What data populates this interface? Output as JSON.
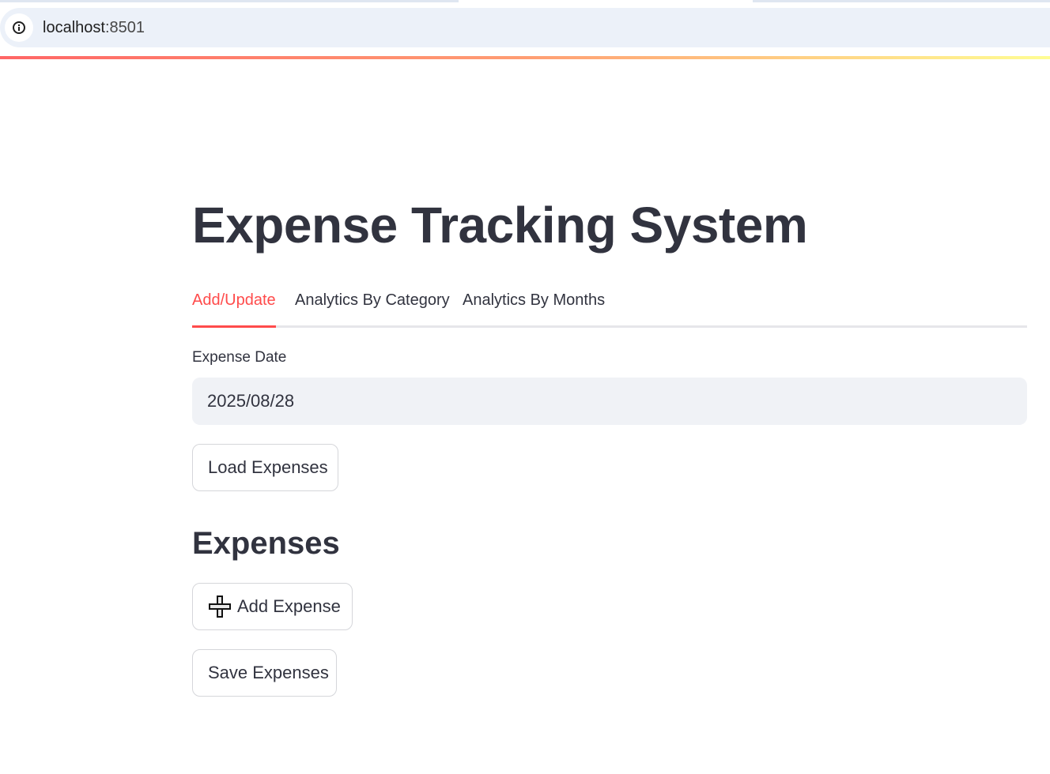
{
  "browser": {
    "url_host": "localhost",
    "url_port": ":8501"
  },
  "page": {
    "title": "Expense Tracking System"
  },
  "tabs": [
    {
      "label": "Add/Update",
      "active": true
    },
    {
      "label": "Analytics By Category",
      "active": false
    },
    {
      "label": "Analytics By Months",
      "active": false
    }
  ],
  "form": {
    "date_label": "Expense Date",
    "date_value": "2025/08/28",
    "load_button": "Load Expenses"
  },
  "expenses": {
    "heading": "Expenses",
    "add_button": "Add Expense",
    "add_button_icon": "plus-icon",
    "save_button": "Save Expenses"
  },
  "colors": {
    "accent": "#ff4b4b",
    "text": "#31333f",
    "input_bg": "#f0f2f6"
  }
}
